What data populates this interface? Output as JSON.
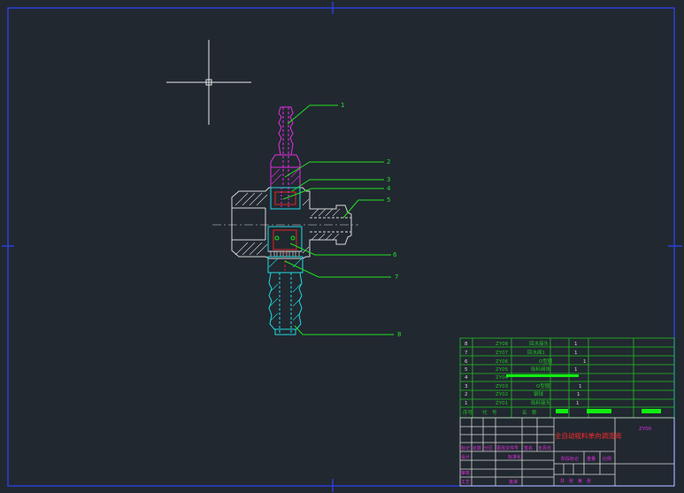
{
  "colors": {
    "background": "#212830",
    "frame": "#2b3fd6",
    "leader": "#22e122",
    "part_magenta": "#e22ee2",
    "part_white": "#d8d8d8",
    "part_cyan": "#22d8e0",
    "part_red": "#e02525",
    "table_line": "#22c122",
    "title_text": "#ff2a2a",
    "label_magenta": "#e22ee2",
    "fill_green": "#11ee11"
  },
  "crosshair": {
    "icon": "crosshair-cursor-icon"
  },
  "callouts": [
    {
      "num": "1"
    },
    {
      "num": "2"
    },
    {
      "num": "3"
    },
    {
      "num": "4"
    },
    {
      "num": "5"
    },
    {
      "num": "6"
    },
    {
      "num": "7"
    },
    {
      "num": "8"
    }
  ],
  "bom": {
    "rows": [
      {
        "idx": "8",
        "code": "ZY08",
        "name": "回水接头",
        "qty": "1"
      },
      {
        "idx": "7",
        "code": "ZY07",
        "name": "回水阀1",
        "qty": "1"
      },
      {
        "idx": "6",
        "code": "ZY06",
        "name": "O型圈",
        "qty": "1"
      },
      {
        "idx": "5",
        "code": "ZY05",
        "name": "吸料阀体",
        "qty": "1"
      },
      {
        "idx": "4",
        "code": "ZY04",
        "name": "",
        "qty": ""
      },
      {
        "idx": "3",
        "code": "ZY03",
        "name": "O型圈",
        "qty": "1"
      },
      {
        "idx": "2",
        "code": "ZY02",
        "name": "钢球",
        "qty": "1"
      },
      {
        "idx": "1",
        "code": "ZY01",
        "name": "吸料接头",
        "qty": "1"
      }
    ],
    "header": {
      "c1": "序号",
      "c2": "代　号",
      "c3": "名　称"
    }
  },
  "title_block": {
    "drawing_title": "全自动吸料单向调流阀",
    "drawing_code": "ZY00",
    "labels": {
      "mark": "标记",
      "count": "处数",
      "zone": "分区",
      "change_doc": "更改文件号",
      "sign": "签名",
      "date": "年月日",
      "design": "设计",
      "standardize": "标准化",
      "stage_mark": "阶段标记",
      "weight": "重量",
      "scale": "比例",
      "review": "审核",
      "process": "工艺",
      "approve": "批准",
      "sheets": "共　张　第　张"
    }
  }
}
